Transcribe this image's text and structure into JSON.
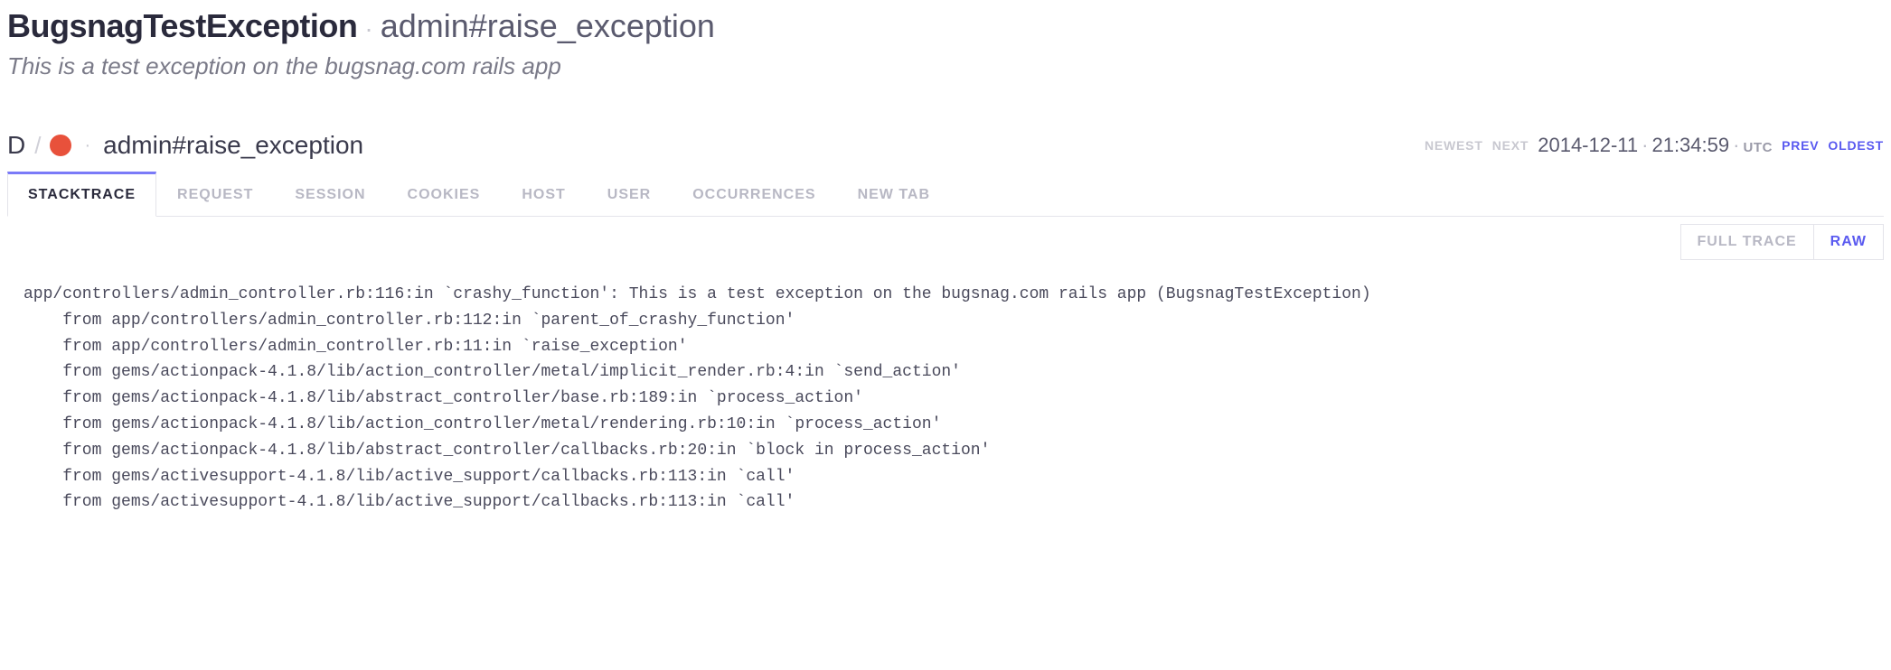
{
  "header": {
    "exception_class": "BugsnagTestException",
    "location": "admin#raise_exception",
    "description": "This is a test exception on the bugsnag.com rails app"
  },
  "event": {
    "diag_letter": "D",
    "context": "admin#raise_exception",
    "nav": {
      "newest": "NEWEST",
      "next": "NEXT",
      "prev": "PREV",
      "oldest": "OLDEST"
    },
    "timestamp": {
      "date": "2014-12-11",
      "time": "21:34:59",
      "tz": "UTC"
    }
  },
  "tabs": {
    "stacktrace": "STACKTRACE",
    "request": "REQUEST",
    "session": "SESSION",
    "cookies": "COOKIES",
    "host": "HOST",
    "user": "USER",
    "occurrences": "OCCURRENCES",
    "new_tab": "NEW TAB"
  },
  "trace_toggle": {
    "full_trace": "FULL TRACE",
    "raw": "RAW"
  },
  "stacktrace_raw": "app/controllers/admin_controller.rb:116:in `crashy_function': This is a test exception on the bugsnag.com rails app (BugsnagTestException)\n    from app/controllers/admin_controller.rb:112:in `parent_of_crashy_function'\n    from app/controllers/admin_controller.rb:11:in `raise_exception'\n    from gems/actionpack-4.1.8/lib/action_controller/metal/implicit_render.rb:4:in `send_action'\n    from gems/actionpack-4.1.8/lib/abstract_controller/base.rb:189:in `process_action'\n    from gems/actionpack-4.1.8/lib/action_controller/metal/rendering.rb:10:in `process_action'\n    from gems/actionpack-4.1.8/lib/abstract_controller/callbacks.rb:20:in `block in process_action'\n    from gems/activesupport-4.1.8/lib/active_support/callbacks.rb:113:in `call'\n    from gems/activesupport-4.1.8/lib/active_support/callbacks.rb:113:in `call'"
}
